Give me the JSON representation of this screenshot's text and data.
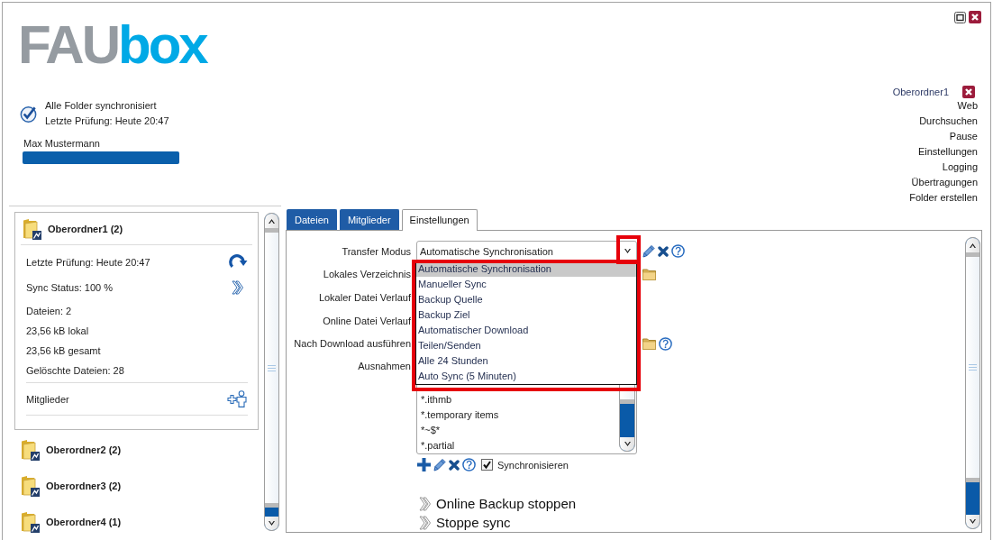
{
  "logo": [
    "FAU",
    "box"
  ],
  "status": {
    "synced": true,
    "title": "Alle Folder synchronisiert",
    "last_check": "Letzte Prüfung: Heute 20:47"
  },
  "user": {
    "name": "Max Mustermann",
    "storage": {
      "level": 1
    }
  },
  "folder_menu": {
    "title": "Oberordner1",
    "items": [
      "Web",
      "Durchsuchen",
      "Pause",
      "Einstellungen",
      "Logging",
      "Übertragungen",
      "Folder erstellen"
    ]
  },
  "folders": [
    {
      "name": "Oberordner1 (2)",
      "expanded": true,
      "details": [
        {
          "kind": "refresh",
          "text": "Letzte Prüfung: Heute 20:47"
        },
        {
          "kind": "details",
          "text": "Sync Status: 100 %"
        },
        {
          "kind": "plain",
          "text": "Dateien: 2"
        },
        {
          "kind": "plain",
          "text": "23,56 kB lokal"
        },
        {
          "kind": "plain",
          "text": "23,56 kB gesamt"
        },
        {
          "kind": "plain",
          "text": "Gelöschte Dateien: 28"
        },
        {
          "kind": "members",
          "text": "Mitglieder"
        }
      ]
    },
    {
      "name": "Oberordner2 (2)",
      "expanded": false
    },
    {
      "name": "Oberordner3 (2)",
      "expanded": false
    },
    {
      "name": "Oberordner4 (1)",
      "expanded": false
    }
  ],
  "tabs": [
    {
      "label": "Dateien",
      "selected": false
    },
    {
      "label": "Mitglieder",
      "selected": false
    },
    {
      "label": "Einstellungen",
      "selected": true
    }
  ],
  "settings": {
    "transfer_mode": {
      "label": "Transfer Modus",
      "value": "Automatische Synchronisation",
      "expanded": true,
      "options": [
        {
          "label": "Automatische Synchronisation",
          "selected": true
        },
        {
          "label": "Manueller Sync",
          "selected": false
        },
        {
          "label": "Backup Quelle",
          "selected": false
        },
        {
          "label": "Backup Ziel",
          "selected": false
        },
        {
          "label": "Automatischer Download",
          "selected": false
        },
        {
          "label": "Teilen/Senden",
          "selected": false
        },
        {
          "label": "Alle 24 Stunden",
          "selected": false
        },
        {
          "label": "Auto Sync (5 Minuten)",
          "selected": false
        }
      ]
    },
    "fields": [
      {
        "label": "Lokales Verzeichnis",
        "kind": "folder"
      },
      {
        "label": "Lokaler Datei Verlauf",
        "kind": "plain"
      },
      {
        "label": "Online Datei Verlauf",
        "kind": "plain"
      },
      {
        "label": "Nach Download ausführen",
        "kind": "folder_help"
      }
    ],
    "exclusions": {
      "label": "Ausnahmen",
      "items": [
        "*.ithmb",
        "*.temporary items",
        "*~$*",
        "*.partial"
      ],
      "sync": {
        "label": "Synchronisieren",
        "checked": true
      }
    },
    "actions": [
      "Online Backup stoppen",
      "Stoppe sync"
    ]
  }
}
